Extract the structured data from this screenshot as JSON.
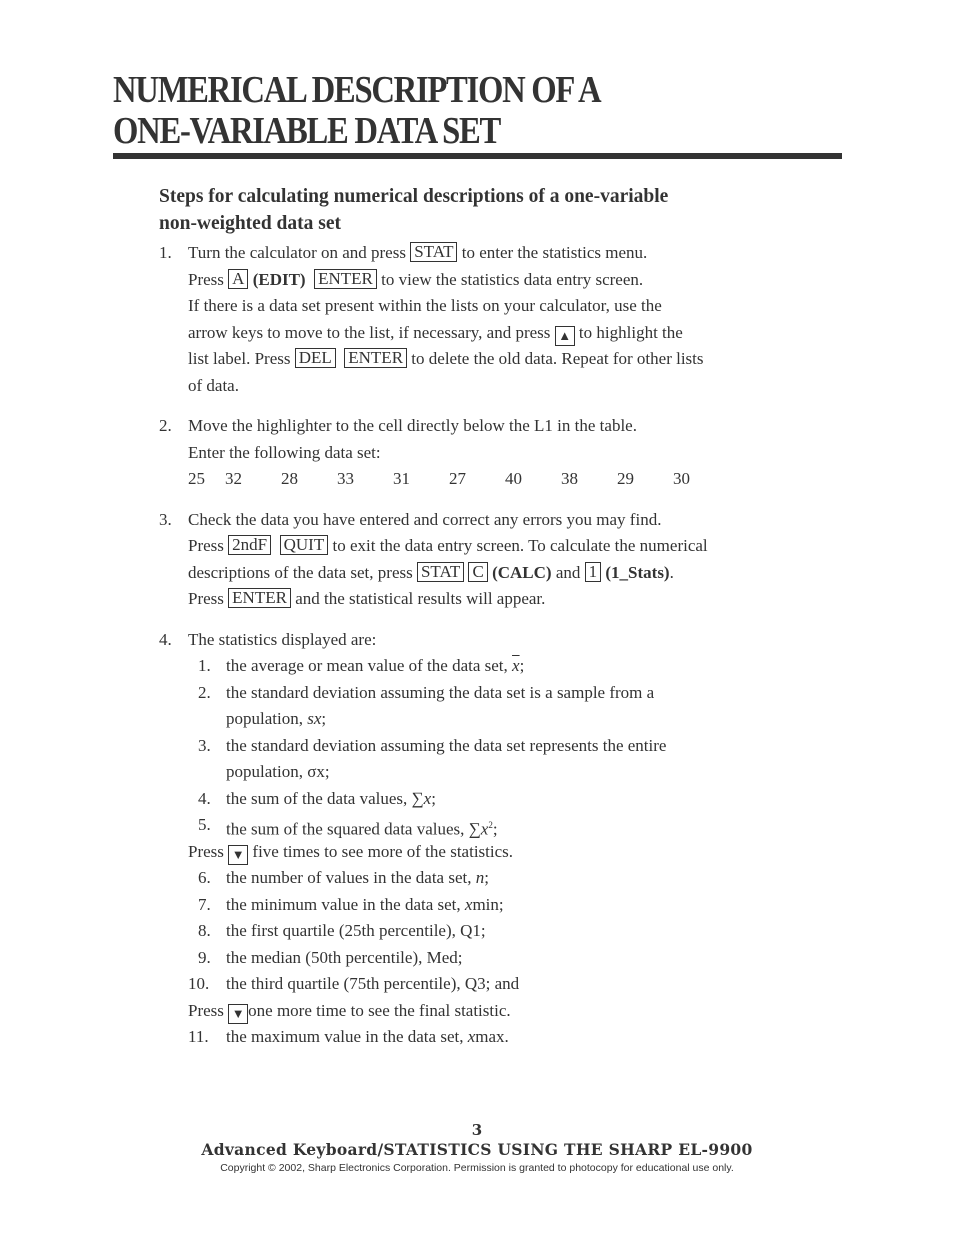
{
  "title": {
    "line1": "NUMERICAL DESCRIPTION OF A",
    "line2": "ONE-VARIABLE DATA SET"
  },
  "subheading": {
    "line1": "Steps for calculating numerical descriptions of a one-variable",
    "line2": "non-weighted data set"
  },
  "step1": {
    "num": "1.",
    "l1a": "Turn the calculator on and press",
    "k_stat": "STAT",
    "l1b": "to enter the statistics menu.",
    "l2a": "Press",
    "k_a": "A",
    "edit": "(EDIT)",
    "k_enter": "ENTER",
    "l2b": "to view the statistics data entry screen.",
    "l3": "If there is a data set present within the lists on your calculator,  use the",
    "l4a": "arrow keys to move to the list, if necessary, and press",
    "k_up": "▲",
    "l4b": "to highlight the",
    "l5a": "list label.  Press",
    "k_del": "DEL",
    "k_enter2": "ENTER",
    "l5b": "to delete the old data.  Repeat for other lists",
    "l6": "of data."
  },
  "step2": {
    "num": "2.",
    "l1": "Move the highlighter to the cell directly below the L1 in the table.",
    "l2": "Enter the following data set:",
    "data": [
      "25",
      "32",
      "28",
      "33",
      "31",
      "27",
      "40",
      "38",
      "29",
      "30"
    ]
  },
  "step3": {
    "num": "3.",
    "l1": "Check the data you have entered and correct any errors you may find.",
    "l2a": "Press",
    "k_2ndf": "2ndF",
    "k_quit": "QUIT",
    "l2b": "to exit the data entry screen.  To calculate the numerical",
    "l3a": "descriptions of the data set, press",
    "k_stat": "STAT",
    "k_c": "C",
    "calc": "(CALC)",
    "and": "and",
    "k_1": "1",
    "stats": "(1_Stats)",
    "period": ".",
    "l4a": "Press",
    "k_enter": "ENTER",
    "l4b": "and the statistical results will appear."
  },
  "step4": {
    "num": "4.",
    "l1": "The statistics displayed are:",
    "items": [
      {
        "n": "1.",
        "t": "the average or mean value of the data set, ",
        "sym": "x",
        "end": ";"
      },
      {
        "n": "2.",
        "t": "the standard deviation assuming the data set is a sample from a",
        "t2": "population, ",
        "sym": "sx",
        "end": ";"
      },
      {
        "n": "3.",
        "t": "the standard deviation assuming the data set represents the entire",
        "t2": "population, σx;"
      },
      {
        "n": "4.",
        "t": "the sum of the data values, ∑",
        "sym": "x",
        "end": ";"
      },
      {
        "n": "5.",
        "t": "the sum of the squared data values, ∑",
        "sym": "x",
        "sup": "2",
        "end": ";"
      },
      {
        "n": "6.",
        "t": "the number of values in the data set, ",
        "sym": "n",
        "end": ";"
      },
      {
        "n": "7.",
        "t": "the minimum value in the data set, ",
        "sym": "x",
        "end": "min;"
      },
      {
        "n": "8.",
        "t": "the first quartile (25th percentile), Q1;"
      },
      {
        "n": "9.",
        "t": "the median (50th percentile), Med;"
      },
      {
        "n": "10.",
        "t": "the third quartile (75th percentile), Q3; and"
      },
      {
        "n": "11.",
        "t": "the maximum value in the data set, ",
        "sym": "x",
        "end": "max."
      }
    ],
    "press1a": "Press",
    "k_down": "▼",
    "press1b": "five times to see more of the statistics.",
    "press2a": "Press",
    "press2b": "one more time to see the final statistic."
  },
  "footer": {
    "page": "3",
    "title": "Advanced Keyboard/STATISTICS USING THE SHARP EL-9900",
    "copyright": "Copyright © 2002, Sharp Electronics Corporation.  Permission is granted to photocopy for educational use only."
  }
}
